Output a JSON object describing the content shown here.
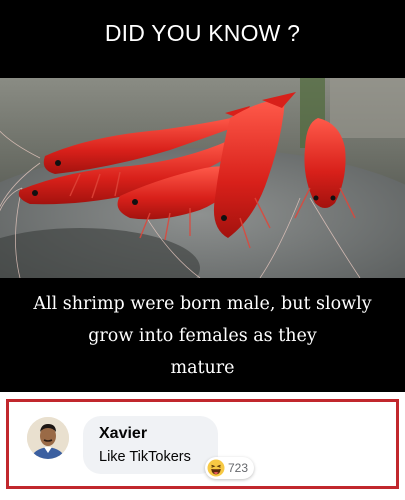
{
  "meme": {
    "title": "DID YOU KNOW ?",
    "caption_lines": [
      "All shrimp were born male, but slowly",
      "grow into females as they",
      "mature"
    ]
  },
  "comment": {
    "author": "Xavier",
    "text": "Like TikTokers",
    "reaction_icon": "haha-emoji-icon",
    "reaction_count": "723",
    "frame_color": "#c1272d"
  }
}
